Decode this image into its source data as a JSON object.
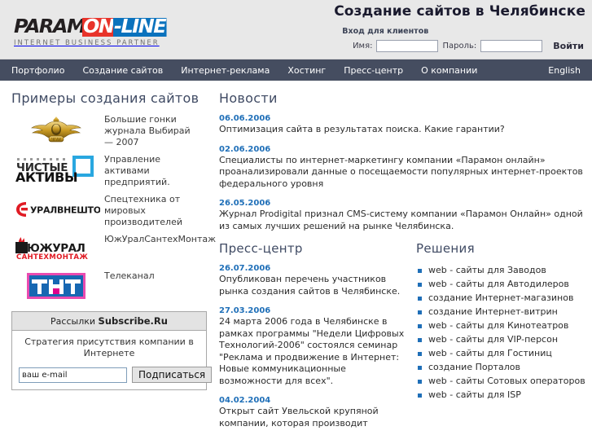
{
  "brand": {
    "logo_part1": "PARAM",
    "logo_part2": "ON",
    "logo_part3": "-LINE",
    "tagline": "INTERNET BUSINESS PARTNER",
    "color_red": "#e8332a",
    "color_blue": "#0a72bd",
    "color_black": "#231f20"
  },
  "header": {
    "site_title": "Создание сайтов в Челябинске",
    "login_heading": "Вход для клиентов",
    "name_label": "Имя:",
    "name_value": "",
    "name_placeholder": "",
    "password_label": "Пароль:",
    "password_value": "",
    "password_placeholder": "",
    "submit_label": "Войти"
  },
  "nav": {
    "items": [
      {
        "label": "Портфолио"
      },
      {
        "label": "Создание сайтов"
      },
      {
        "label": "Интернет-реклама"
      },
      {
        "label": "Хостинг"
      },
      {
        "label": "Пресс-центр"
      },
      {
        "label": "О компании"
      }
    ],
    "right_item": {
      "label": "English"
    },
    "background": "#454d60"
  },
  "portfolio": {
    "title": "Примеры создания сайтов",
    "items": [
      {
        "logo": "eagle-emblem-logo",
        "text": "Большие гонки журнала Выбирай — 2007"
      },
      {
        "logo": "chistye-aktivy-logo",
        "text": "Управление активами предприятий."
      },
      {
        "logo": "uralvneshtorg-logo",
        "text": "Спецтехника от мировых производителей"
      },
      {
        "logo": "yuzhuralsantehmontazh-logo",
        "text": "ЮжУралСантехМонтаж"
      },
      {
        "logo": "tnt-logo",
        "text": "Телеканал"
      }
    ]
  },
  "subscribe": {
    "head_prefix": "Рассылки ",
    "head_brand": "Subscribe.Ru",
    "description": "Стратегия присутствия компании в Интернете",
    "email_value": "ваш e-mail",
    "email_placeholder": "ваш e-mail",
    "button_label": "Подписаться"
  },
  "news": {
    "title": "Новости",
    "items": [
      {
        "date": "06.06.2006",
        "text": "Оптимизация сайта в результатах поиска. Какие гарантии?"
      },
      {
        "date": "02.06.2006",
        "text": "Специалисты по интернет-маркетингу компании «Парамон онлайн» проанализировали данные о посещаемости популярных интернет-проектов федерального уровня"
      },
      {
        "date": "26.05.2006",
        "text": "Журнал Prodigital признал CMS-систему компании «Парамон Онлайн» одной из самых лучших решений на рынке Челябинска."
      }
    ]
  },
  "press": {
    "title": "Пресс-центр",
    "items": [
      {
        "date": "26.07.2006",
        "text": "Опубликован перечень участников рынка создания сайтов в Челябинске."
      },
      {
        "date": "27.03.2006",
        "text": "24 марта 2006 года в Челябинске в рамках программы \"Недели Цифровых Технологий-2006\" состоялся семинар \"Реклама и продвижение в Интернет: Новые коммуникационные возможности для всех\"."
      },
      {
        "date": "04.02.2004",
        "text": "Открыт сайт Увельской крупяной компании, которая производит"
      }
    ]
  },
  "solutions": {
    "title": "Решения",
    "items": [
      {
        "label": "web - сайты для Заводов"
      },
      {
        "label": "web - сайты для Автодилеров"
      },
      {
        "label": "создание Интернет-магазинов"
      },
      {
        "label": "создание Интернет-витрин"
      },
      {
        "label": "web - сайты для Кинотеатров"
      },
      {
        "label": "web - сайты для VIP-персон"
      },
      {
        "label": "web - сайты для Гостиниц"
      },
      {
        "label": "создание Порталов"
      },
      {
        "label": "web - сайты Сотовых операторов"
      },
      {
        "label": "web - сайты для ISP"
      }
    ],
    "bullet_color": "#1f6fb8"
  }
}
